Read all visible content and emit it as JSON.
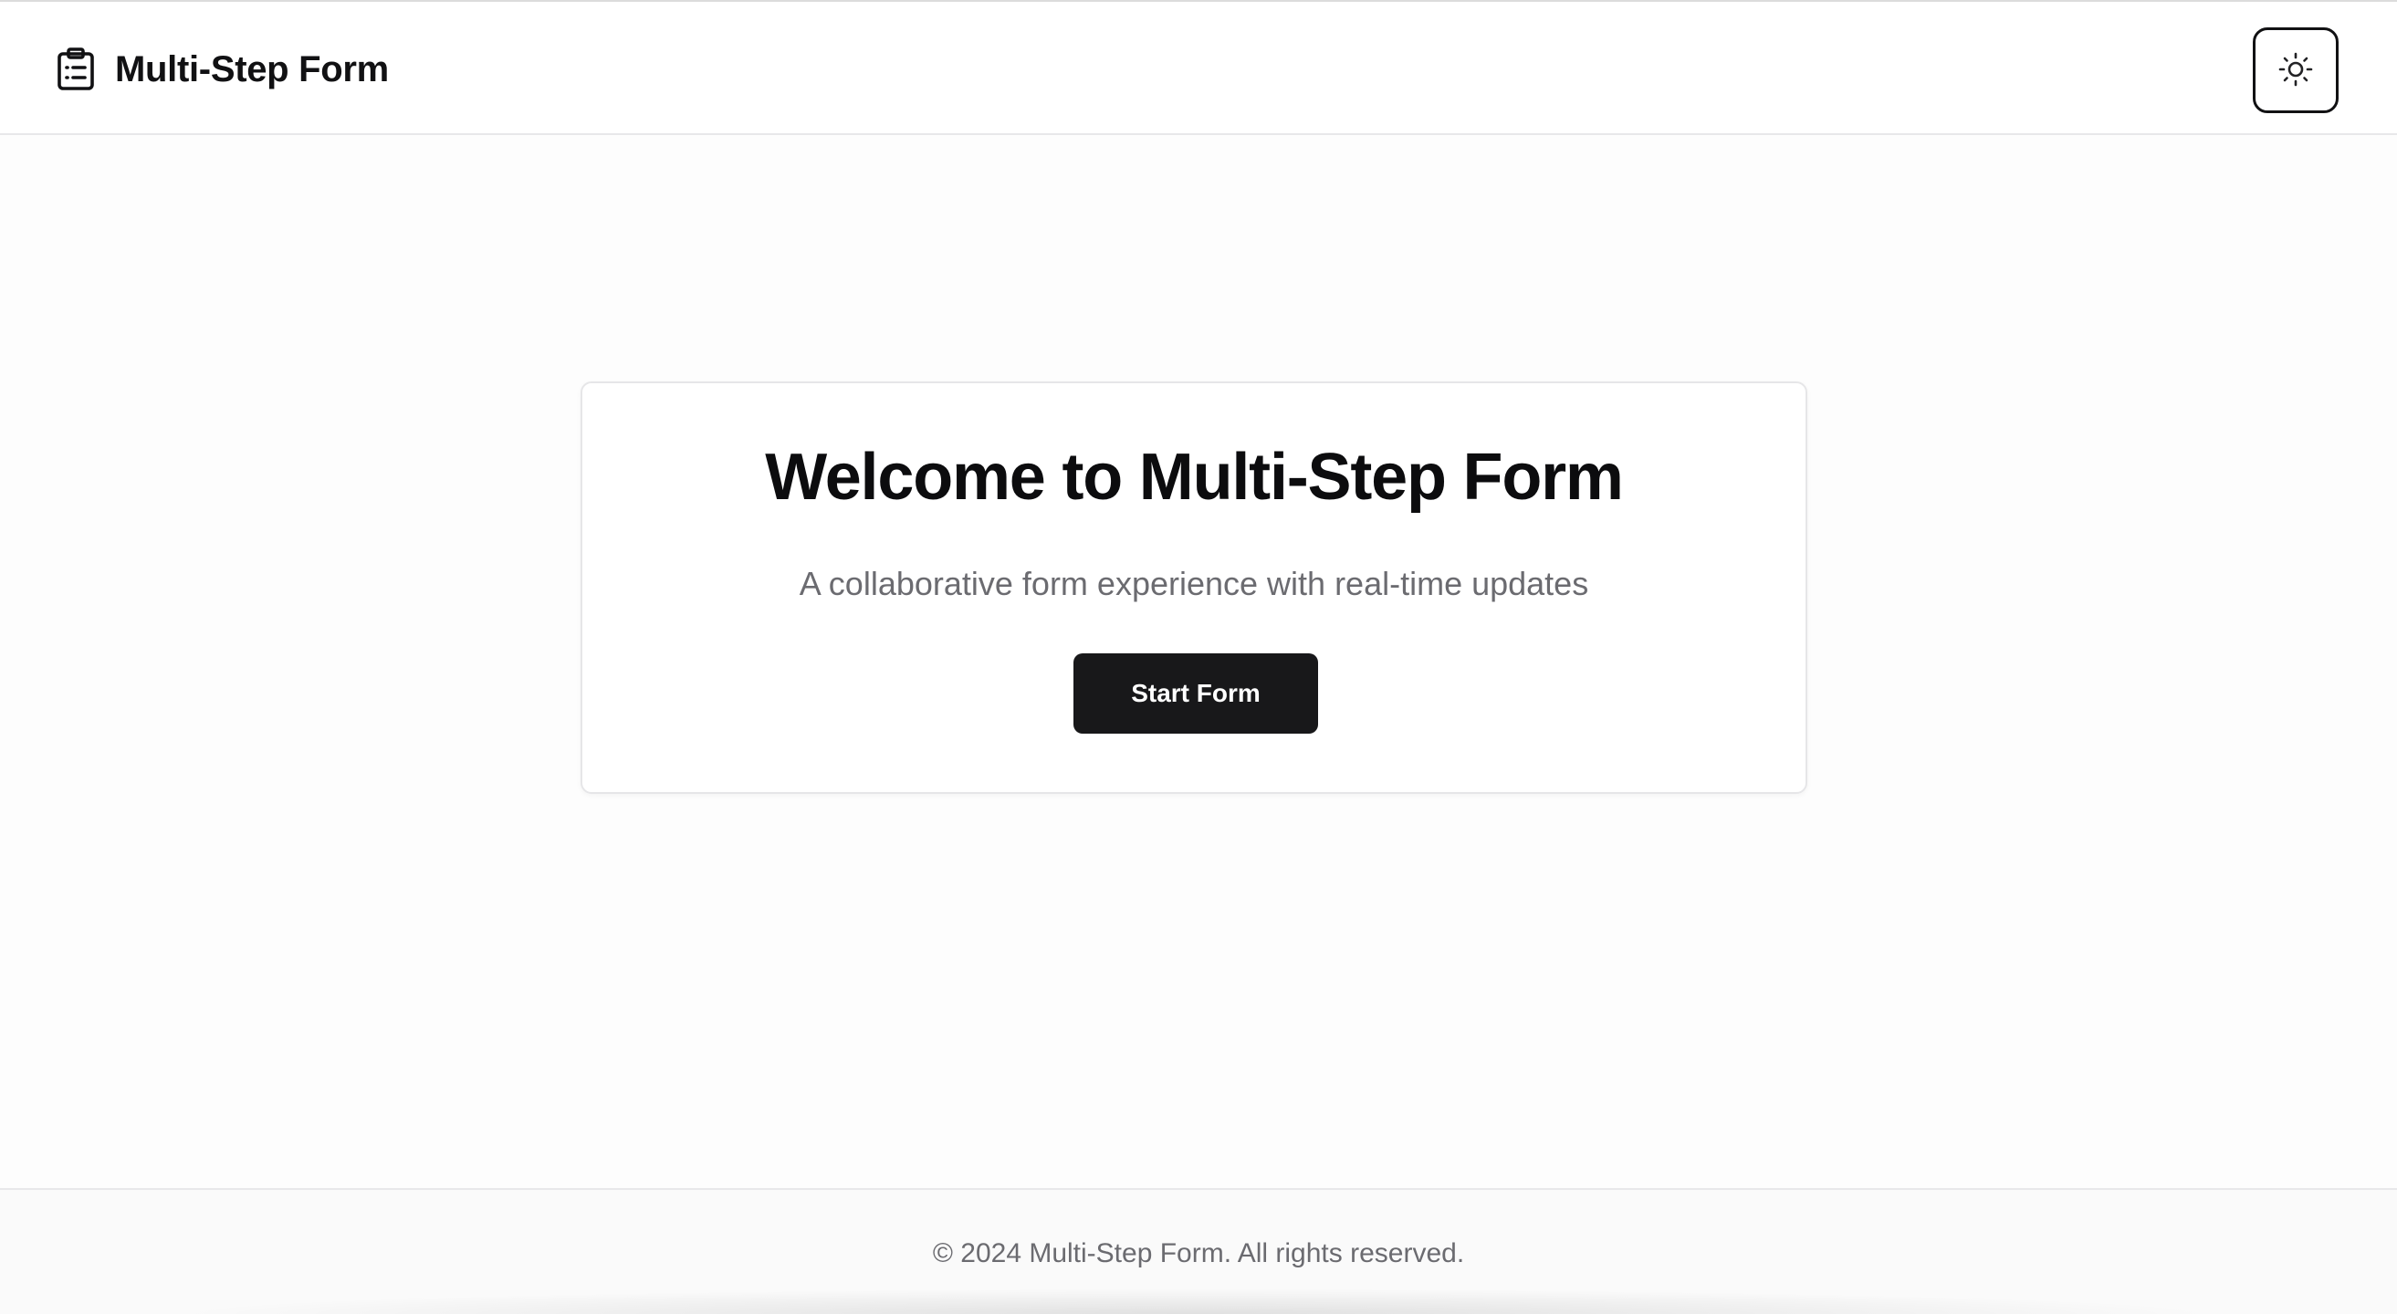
{
  "header": {
    "title": "Multi-Step Form",
    "brand_icon": "clipboard-list-icon",
    "theme_toggle_icon": "sun-icon"
  },
  "main": {
    "title": "Welcome to Multi-Step Form",
    "subtitle": "A collaborative form experience with real-time updates",
    "start_button_label": "Start Form"
  },
  "footer": {
    "text": "© 2024 Multi-Step Form. All rights reserved."
  },
  "colors": {
    "primary_button": "#18181a",
    "muted_text": "#6b6b70",
    "border": "#e6e6e8"
  }
}
